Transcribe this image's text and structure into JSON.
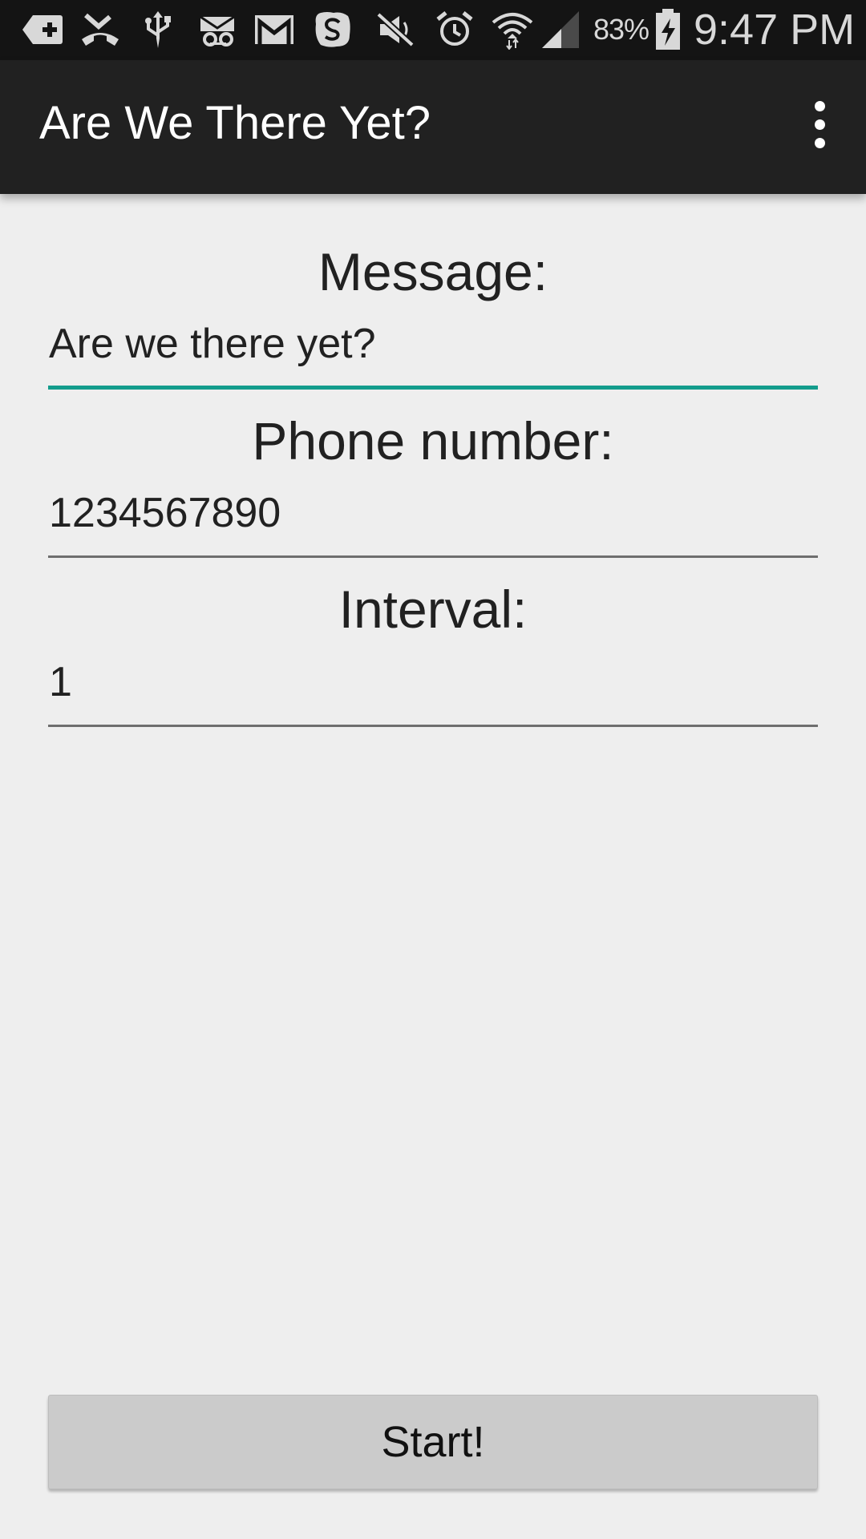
{
  "status_bar": {
    "icons": [
      "add-box-icon",
      "missed-call-icon",
      "usb-icon",
      "voicemail-icon",
      "gmail-icon",
      "skype-icon",
      "mute-icon",
      "alarm-icon",
      "wifi-icon",
      "signal-icon",
      "battery-charging-icon"
    ],
    "battery_percent": "83%",
    "time": "9:47 PM"
  },
  "action_bar": {
    "title": "Are We There Yet?",
    "overflow_icon": "more-vert-icon"
  },
  "form": {
    "message_label": "Message:",
    "message_value": "Are we there yet?",
    "phone_label": "Phone number:",
    "phone_value": "1234567890",
    "interval_label": "Interval:",
    "interval_value": "1"
  },
  "start_button_label": "Start!",
  "colors": {
    "accent": "#139c8c",
    "action_bar": "#212121",
    "status_bar": "#141414",
    "background": "#eeeeee",
    "button": "#cbcbcb"
  }
}
